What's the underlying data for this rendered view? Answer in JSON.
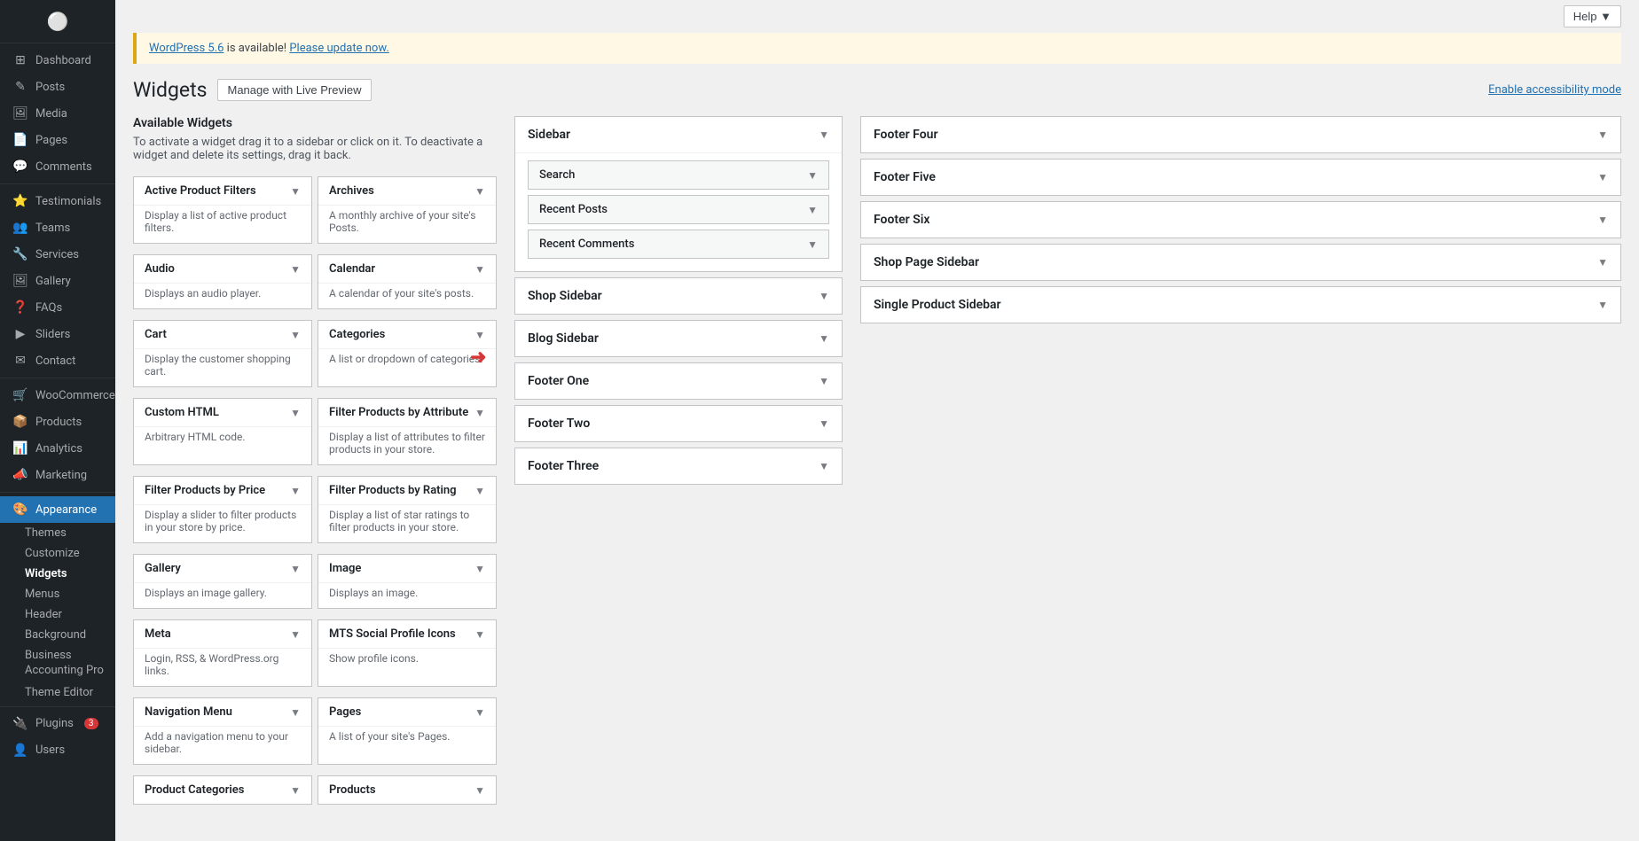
{
  "topbar": {
    "help_label": "Help ▼",
    "accessibility_label": "Enable accessibility mode"
  },
  "notice": {
    "text": " is available! ",
    "link1": "WordPress 5.6",
    "link2": "Please update now."
  },
  "page": {
    "title": "Widgets",
    "live_preview_btn": "Manage with Live Preview"
  },
  "available_widgets": {
    "title": "Available Widgets",
    "description": "To activate a widget drag it to a sidebar or click on it. To deactivate a widget and delete its settings, drag it back."
  },
  "widgets": [
    {
      "title": "Active Product Filters",
      "desc": "Display a list of active product filters."
    },
    {
      "title": "Archives",
      "desc": "A monthly archive of your site's Posts."
    },
    {
      "title": "Audio",
      "desc": "Displays an audio player."
    },
    {
      "title": "Calendar",
      "desc": "A calendar of your site's posts."
    },
    {
      "title": "Cart",
      "desc": "Display the customer shopping cart."
    },
    {
      "title": "Categories",
      "desc": "A list or dropdown of categories."
    },
    {
      "title": "Custom HTML",
      "desc": "Arbitrary HTML code."
    },
    {
      "title": "Filter Products by Attribute",
      "desc": "Display a list of attributes to filter products in your store."
    },
    {
      "title": "Filter Products by Price",
      "desc": "Display a slider to filter products in your store by price."
    },
    {
      "title": "Filter Products by Rating",
      "desc": "Display a list of star ratings to filter products in your store."
    },
    {
      "title": "Gallery",
      "desc": "Displays an image gallery."
    },
    {
      "title": "Image",
      "desc": "Displays an image."
    },
    {
      "title": "Meta",
      "desc": "Login, RSS, & WordPress.org links."
    },
    {
      "title": "MTS Social Profile Icons",
      "desc": "Show profile icons."
    },
    {
      "title": "Navigation Menu",
      "desc": "Add a navigation menu to your sidebar."
    },
    {
      "title": "Pages",
      "desc": "A list of your site's Pages."
    },
    {
      "title": "Product Categories",
      "desc": ""
    },
    {
      "title": "Products",
      "desc": ""
    }
  ],
  "sidebar_sections": [
    {
      "title": "Sidebar",
      "widgets": [
        {
          "title": "Search"
        },
        {
          "title": "Recent Posts"
        },
        {
          "title": "Recent Comments"
        }
      ]
    },
    {
      "title": "Shop Sidebar",
      "widgets": []
    },
    {
      "title": "Blog Sidebar",
      "widgets": []
    },
    {
      "title": "Footer One",
      "widgets": []
    },
    {
      "title": "Footer Two",
      "widgets": []
    },
    {
      "title": "Footer Three",
      "widgets": []
    }
  ],
  "right_sections": [
    {
      "title": "Footer Four"
    },
    {
      "title": "Footer Five"
    },
    {
      "title": "Footer Six"
    },
    {
      "title": "Shop Page Sidebar"
    },
    {
      "title": "Single Product Sidebar"
    }
  ],
  "sidebar_nav": {
    "items": [
      {
        "label": "Dashboard",
        "icon": "⊞",
        "active": false
      },
      {
        "label": "Posts",
        "icon": "✎",
        "active": false
      },
      {
        "label": "Media",
        "icon": "🖼",
        "active": false
      },
      {
        "label": "Pages",
        "icon": "📄",
        "active": false
      },
      {
        "label": "Comments",
        "icon": "💬",
        "active": false
      },
      {
        "label": "Testimonials",
        "icon": "⭐",
        "active": false
      },
      {
        "label": "Teams",
        "icon": "👥",
        "active": false
      },
      {
        "label": "Services",
        "icon": "🔧",
        "active": false
      },
      {
        "label": "Gallery",
        "icon": "🖼",
        "active": false
      },
      {
        "label": "FAQs",
        "icon": "❓",
        "active": false
      },
      {
        "label": "Sliders",
        "icon": "▶",
        "active": false
      },
      {
        "label": "Contact",
        "icon": "✉",
        "active": false
      },
      {
        "label": "WooCommerce",
        "icon": "🛒",
        "active": false
      },
      {
        "label": "Products",
        "icon": "📦",
        "active": false
      },
      {
        "label": "Analytics",
        "icon": "📊",
        "active": false
      },
      {
        "label": "Marketing",
        "icon": "📣",
        "active": false
      },
      {
        "label": "Appearance",
        "icon": "🎨",
        "active": true
      }
    ],
    "appearance_sub": [
      {
        "label": "Themes",
        "active": false
      },
      {
        "label": "Customize",
        "active": false
      },
      {
        "label": "Widgets",
        "active": true
      },
      {
        "label": "Menus",
        "active": false
      },
      {
        "label": "Header",
        "active": false
      },
      {
        "label": "Background",
        "active": false
      },
      {
        "label": "Business Accounting Pro",
        "active": false
      },
      {
        "label": "Theme Editor",
        "active": false
      }
    ],
    "bottom_items": [
      {
        "label": "Plugins",
        "icon": "🔌",
        "badge": "3"
      },
      {
        "label": "Users",
        "icon": "👤"
      }
    ]
  }
}
